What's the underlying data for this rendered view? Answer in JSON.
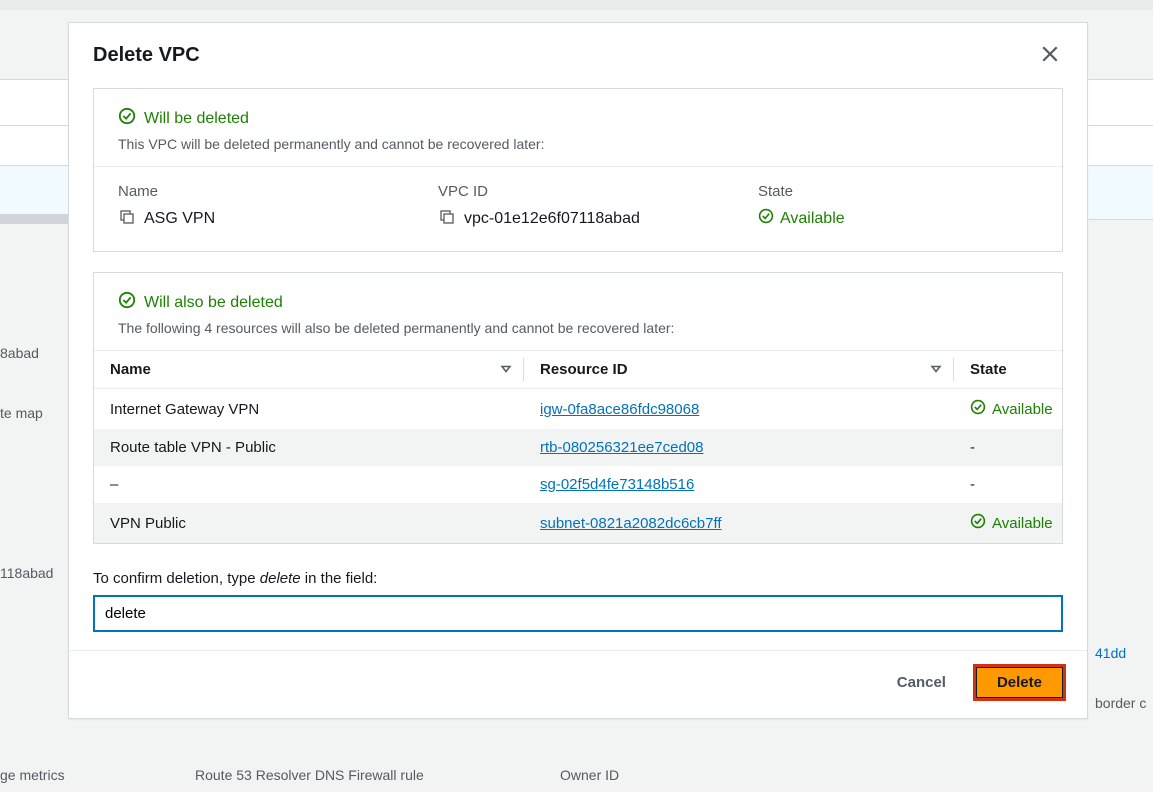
{
  "modal": {
    "title": "Delete VPC",
    "willDeleted": {
      "heading": "Will be deleted",
      "desc": "This VPC will be deleted permanently and cannot be recovered later:",
      "nameLabel": "Name",
      "nameVal": "ASG VPN",
      "vpcidLabel": "VPC ID",
      "vpcidVal": "vpc-01e12e6f07118abad",
      "stateLabel": "State",
      "stateVal": "Available"
    },
    "alsoDeleted": {
      "heading": "Will also be deleted",
      "desc": "The following 4 resources will also be deleted permanently and cannot be recovered later:",
      "columns": {
        "name": "Name",
        "id": "Resource ID",
        "state": "State"
      },
      "rows": [
        {
          "name": "Internet Gateway VPN",
          "id": "igw-0fa8ace86fdc98068",
          "state": "Available",
          "hasState": true
        },
        {
          "name": "Route table VPN - Public",
          "id": "rtb-080256321ee7ced08",
          "state": "-",
          "hasState": false
        },
        {
          "name": "–",
          "id": "sg-02f5d4fe73148b516",
          "state": "-",
          "hasState": false
        },
        {
          "name": "VPN Public",
          "id": "subnet-0821a2082dc6cb7ff",
          "state": "Available",
          "hasState": true
        }
      ]
    },
    "confirm": {
      "labelPrefix": "To confirm deletion, type ",
      "labelKeyword": "delete",
      "labelSuffix": " in the field:",
      "value": "delete"
    },
    "buttons": {
      "cancel": "Cancel",
      "delete": "Delete"
    }
  },
  "background": {
    "h1": "8abad",
    "h2": "te map",
    "h3": "118abad",
    "h4": "ge metrics",
    "h5": "Route 53 Resolver DNS Firewall rule",
    "h6": "Owner ID",
    "h7": "41dd",
    "h8": "border c"
  }
}
